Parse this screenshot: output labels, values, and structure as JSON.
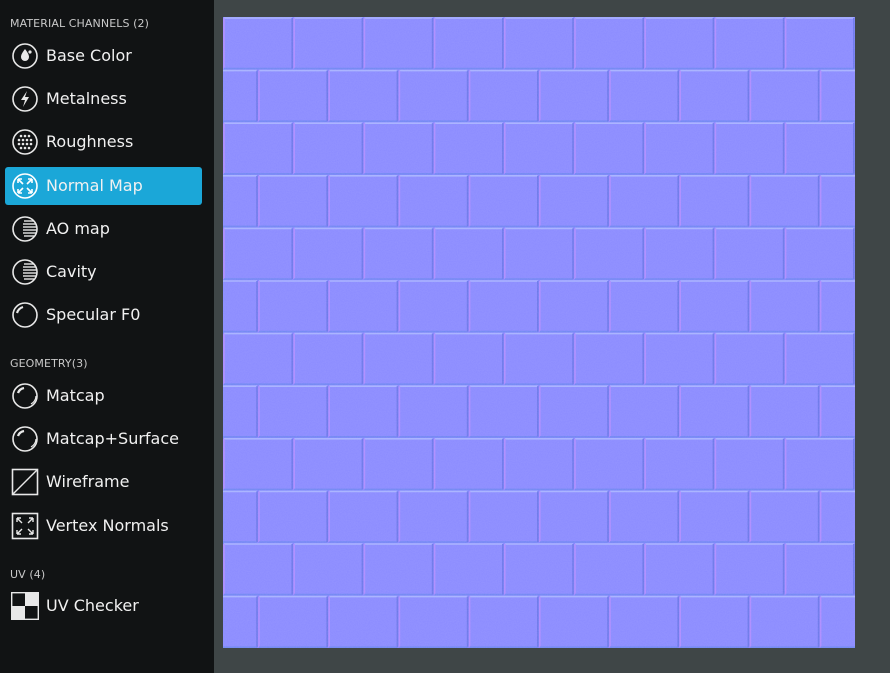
{
  "sidebar": {
    "sections": [
      {
        "title": "MATERIAL CHANNELS (2)",
        "items": [
          {
            "label": "Base Color",
            "icon": "base-color-drop-icon",
            "active": false
          },
          {
            "label": "Metalness",
            "icon": "metalness-bolt-icon",
            "active": false
          },
          {
            "label": "Roughness",
            "icon": "roughness-dots-icon",
            "active": false
          },
          {
            "label": "Normal Map",
            "icon": "normal-map-arrows-icon",
            "active": true
          },
          {
            "label": "AO map",
            "icon": "ao-map-stripes-icon",
            "active": false
          },
          {
            "label": "Cavity",
            "icon": "cavity-stripes-icon",
            "active": false
          },
          {
            "label": "Specular F0",
            "icon": "specular-sphere-icon",
            "active": false
          }
        ]
      },
      {
        "title": "GEOMETRY(3)",
        "items": [
          {
            "label": "Matcap",
            "icon": "matcap-sphere-icon",
            "active": false
          },
          {
            "label": "Matcap+Surface",
            "icon": "matcap-surface-sphere-icon",
            "active": false
          },
          {
            "label": "Wireframe",
            "icon": "wireframe-icon",
            "active": false
          },
          {
            "label": "Vertex Normals",
            "icon": "vertex-normals-icon",
            "active": false
          }
        ]
      },
      {
        "title": "UV (4)",
        "items": [
          {
            "label": "UV Checker",
            "icon": "uv-checker-icon",
            "active": false
          }
        ]
      }
    ]
  },
  "colors": {
    "sidebar_bg": "#111314",
    "active_accent": "#1ba7d8",
    "viewport_bg": "#3f4647",
    "normal_map_base": "#8080ff"
  }
}
